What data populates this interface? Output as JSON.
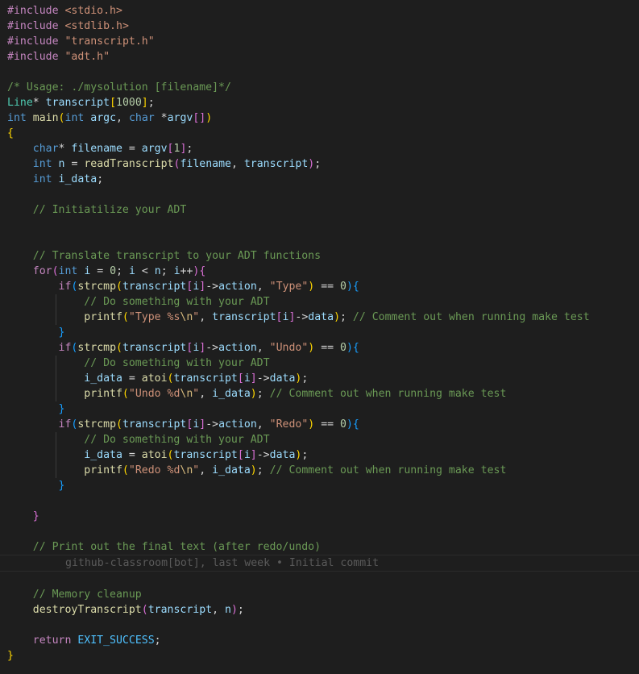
{
  "blame": {
    "text": "github-classroom[bot], last week • Initial commit"
  },
  "tokens": {
    "include": "#include",
    "h_stdio": "<stdio.h>",
    "h_stdlib": "<stdlib.h>",
    "h_transcript": "\"transcript.h\"",
    "h_adt": "\"adt.h\"",
    "usage_comment": "/* Usage: ./mysolution [filename]*/",
    "Line": "Line",
    "transcript": "transcript",
    "n1000": "1000",
    "int": "int",
    "char": "char",
    "main": "main",
    "argc": "argc",
    "argv": "argv",
    "filename": "filename",
    "n": "n",
    "readTranscript": "readTranscript",
    "i_data": "i_data",
    "cmt_init": "// Initiatilize your ADT",
    "cmt_translate": "// Translate transcript to your ADT functions",
    "for": "for",
    "i": "i",
    "zero": "0",
    "one": "1",
    "if": "if",
    "strcmp": "strcmp",
    "action": "action",
    "data": "data",
    "s_type": "\"Type\"",
    "s_undo": "\"Undo\"",
    "s_redo": "\"Redo\"",
    "cmt_do": "// Do something with your ADT",
    "printf": "printf",
    "fmt_type_a": "\"Type %s",
    "fmt_undo_a": "\"Undo %d",
    "fmt_redo_a": "\"Redo %d",
    "esc_n": "\\n",
    "quote": "\"",
    "cmt_make_test": "// Comment out when running make test",
    "atoi": "atoi",
    "cmt_print": "// Print out the final text (after redo/undo)",
    "cmt_mem": "// Memory cleanup",
    "destroyTranscript": "destroyTranscript",
    "return": "return",
    "EXIT_SUCCESS": "EXIT_SUCCESS"
  }
}
